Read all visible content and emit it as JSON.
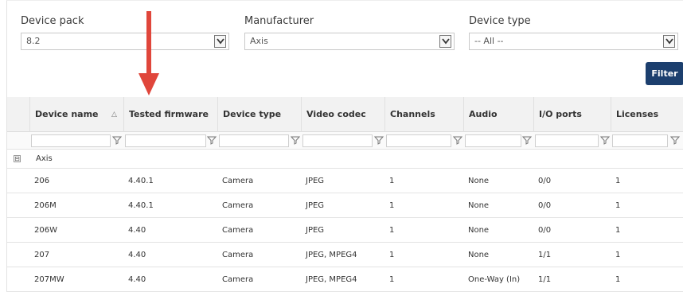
{
  "filters": {
    "device_pack": {
      "label": "Device pack",
      "value": "8.2"
    },
    "manufacturer": {
      "label": "Manufacturer",
      "value": "Axis"
    },
    "device_type": {
      "label": "Device type",
      "value": "-- All --"
    },
    "filter_button": "Filter"
  },
  "grid": {
    "columns": [
      "Device name",
      "Tested firmware",
      "Device type",
      "Video codec",
      "Channels",
      "Audio",
      "I/O ports",
      "Licenses"
    ],
    "group": {
      "toggle": "⊟",
      "name": "Axis"
    },
    "rows": [
      [
        "206",
        "4.40.1",
        "Camera",
        "JPEG",
        "1",
        "None",
        "0/0",
        "1"
      ],
      [
        "206M",
        "4.40.1",
        "Camera",
        "JPEG",
        "1",
        "None",
        "0/0",
        "1"
      ],
      [
        "206W",
        "4.40",
        "Camera",
        "JPEG",
        "1",
        "None",
        "0/0",
        "1"
      ],
      [
        "207",
        "4.40",
        "Camera",
        "JPEG, MPEG4",
        "1",
        "None",
        "1/1",
        "1"
      ],
      [
        "207MW",
        "4.40",
        "Camera",
        "JPEG, MPEG4",
        "1",
        "One-Way (In)",
        "1/1",
        "1"
      ]
    ]
  },
  "colors": {
    "button_bg": "#1c3f6e",
    "annotation_arrow": "#e0463b",
    "header_bg": "#f2f2f2"
  },
  "icons": [
    "chevron-down-icon",
    "sort-icon",
    "funnel-icon",
    "collapse-icon",
    "arrow-annotation-icon"
  ]
}
